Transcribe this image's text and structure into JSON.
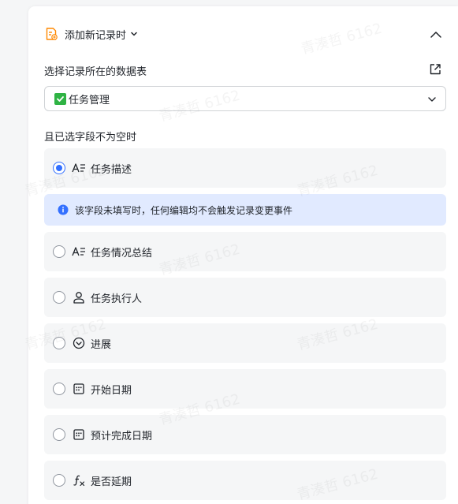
{
  "header": {
    "title": "添加新记录时",
    "icons": {
      "doc": "doc-add-icon",
      "caret": "caret-down-icon",
      "collapse": "chevron-up-icon"
    }
  },
  "table_select": {
    "label": "选择记录所在的数据表",
    "value": "任务管理",
    "open_icon": "external-link-icon"
  },
  "fields_section": {
    "label": "且已选字段不为空时",
    "notice": "该字段未填写时，任何编辑均不会触发记录变更事件",
    "items": [
      {
        "label": "任务描述",
        "icon": "text-field-icon",
        "checked": true
      },
      {
        "label": "任务情况总结",
        "icon": "text-field-icon",
        "checked": false
      },
      {
        "label": "任务执行人",
        "icon": "person-icon",
        "checked": false
      },
      {
        "label": "进展",
        "icon": "single-select-icon",
        "checked": false
      },
      {
        "label": "开始日期",
        "icon": "calendar-icon",
        "checked": false
      },
      {
        "label": "预计完成日期",
        "icon": "calendar-icon",
        "checked": false
      },
      {
        "label": "是否延期",
        "icon": "formula-icon",
        "checked": false
      }
    ]
  },
  "watermark": "青湊哲 6162",
  "colors": {
    "accent": "#3370ff",
    "notice_bg": "#e1eaff",
    "item_bg": "#f5f6f7",
    "doc_icon": "#ff8800"
  }
}
